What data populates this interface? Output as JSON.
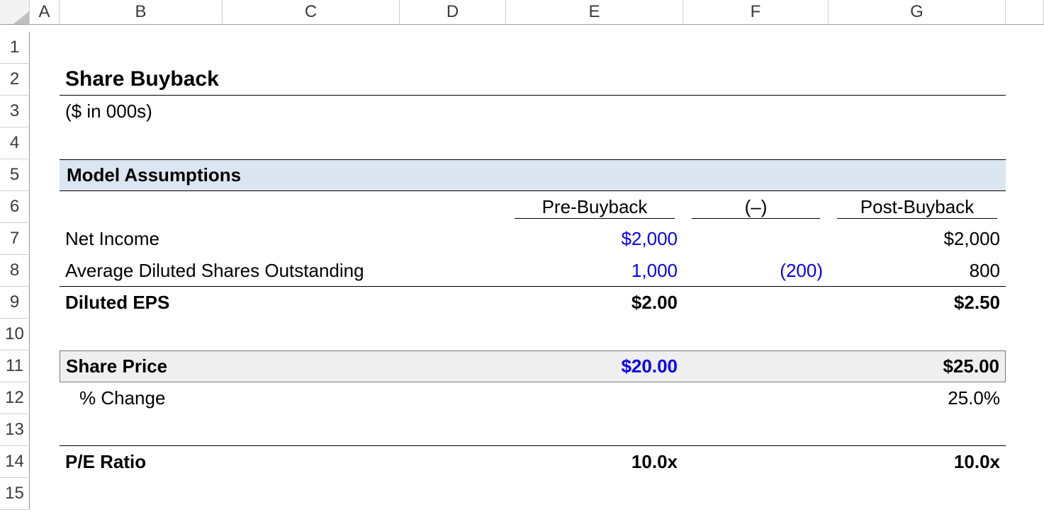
{
  "columns": [
    "A",
    "B",
    "C",
    "D",
    "E",
    "F",
    "G"
  ],
  "rows": [
    "1",
    "2",
    "3",
    "4",
    "5",
    "6",
    "7",
    "8",
    "9",
    "10",
    "11",
    "12",
    "13",
    "14",
    "15"
  ],
  "title": "Share Buyback",
  "subtitle": "($ in 000s)",
  "section": "Model Assumptions",
  "headers": {
    "pre": "Pre-Buyback",
    "delta": "(–)",
    "post": "Post-Buyback"
  },
  "rows_data": {
    "net_income": {
      "label": "Net Income",
      "pre": "$2,000",
      "delta": "",
      "post": "$2,000"
    },
    "avg_diluted": {
      "label": "Average Diluted Shares Outstanding",
      "pre": "1,000",
      "delta": "(200)",
      "post": "800"
    },
    "diluted_eps": {
      "label": "Diluted EPS",
      "pre": "$2.00",
      "delta": "",
      "post": "$2.50"
    },
    "share_price": {
      "label": "Share Price",
      "pre": "$20.00",
      "delta": "",
      "post": "$25.00"
    },
    "pct_change": {
      "label": "% Change",
      "pre": "",
      "delta": "",
      "post": "25.0%"
    },
    "pe_ratio": {
      "label": "P/E Ratio",
      "pre": "10.0x",
      "delta": "",
      "post": "10.0x"
    }
  }
}
